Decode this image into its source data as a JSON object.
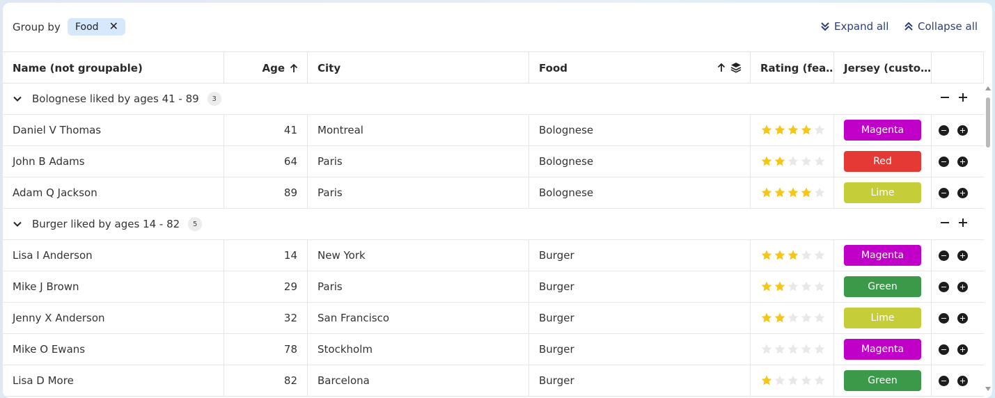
{
  "toolbar": {
    "group_by_label": "Group by",
    "chip_label": "Food",
    "expand_all": "Expand all",
    "collapse_all": "Collapse all"
  },
  "columns": [
    "Name (not groupable)",
    "Age",
    "City",
    "Food",
    "Rating (fea…",
    "Jersey (custo…"
  ],
  "groups": [
    {
      "label": "Bolognese liked by ages 41 - 89",
      "count": "3",
      "rows": [
        {
          "name": "Daniel V Thomas",
          "age": "41",
          "city": "Montreal",
          "food": "Bolognese",
          "rating": 4,
          "jersey": "Magenta",
          "jersey_color": "#c000c8"
        },
        {
          "name": "John B Adams",
          "age": "64",
          "city": "Paris",
          "food": "Bolognese",
          "rating": 2,
          "jersey": "Red",
          "jersey_color": "#e53935"
        },
        {
          "name": "Adam Q Jackson",
          "age": "89",
          "city": "Paris",
          "food": "Bolognese",
          "rating": 4,
          "jersey": "Lime",
          "jersey_color": "#c5cd38"
        }
      ]
    },
    {
      "label": "Burger liked by ages 14 - 82",
      "count": "5",
      "rows": [
        {
          "name": "Lisa I Anderson",
          "age": "14",
          "city": "New York",
          "food": "Burger",
          "rating": 3,
          "jersey": "Magenta",
          "jersey_color": "#c000c8"
        },
        {
          "name": "Mike J Brown",
          "age": "29",
          "city": "Paris",
          "food": "Burger",
          "rating": 2,
          "jersey": "Green",
          "jersey_color": "#3a9a4a"
        },
        {
          "name": "Jenny X Anderson",
          "age": "32",
          "city": "San Francisco",
          "food": "Burger",
          "rating": 2,
          "jersey": "Lime",
          "jersey_color": "#c5cd38"
        },
        {
          "name": "Mike O Ewans",
          "age": "78",
          "city": "Stockholm",
          "food": "Burger",
          "rating": 0,
          "jersey": "Magenta",
          "jersey_color": "#c000c8"
        },
        {
          "name": "Lisa D More",
          "age": "82",
          "city": "Barcelona",
          "food": "Burger",
          "rating": 1,
          "jersey": "Green",
          "jersey_color": "#3a9a4a"
        }
      ]
    }
  ],
  "colors": {
    "star_on": "#f5c518",
    "star_off": "#e8e8e8",
    "accent": "#2c3e74",
    "chip": "#d6e8fb"
  }
}
